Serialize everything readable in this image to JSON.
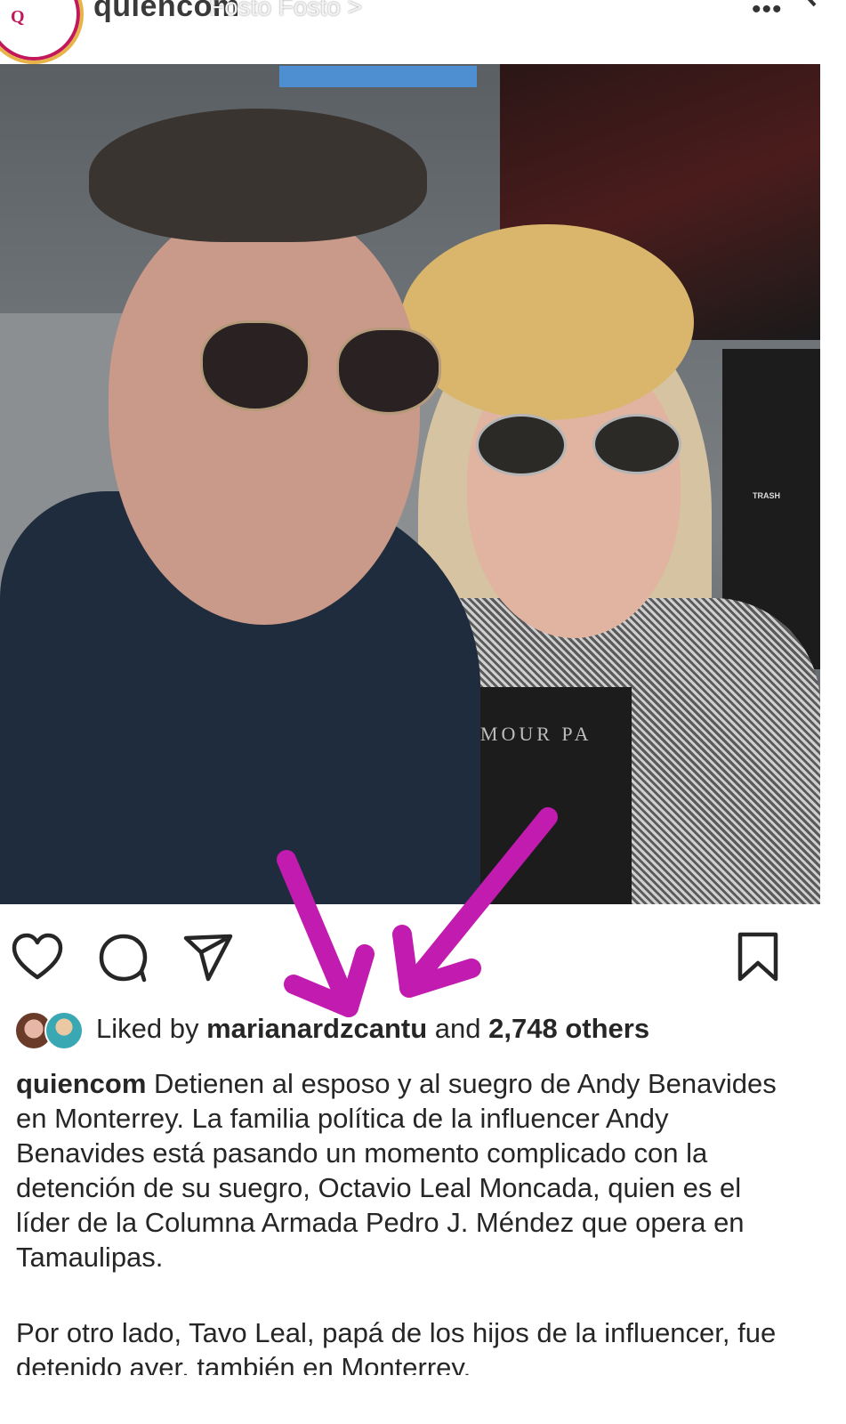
{
  "header": {
    "account_name": "quiencom",
    "logo_text": "Q",
    "audio_label": "Fosto Fosto >",
    "more_icon": "more-icon",
    "close_icon": "close-icon"
  },
  "photo": {
    "sign_text": "",
    "bin_text": "TRASH",
    "shirt_text": "AMOUR PA"
  },
  "actions": {
    "like_icon": "heart-icon",
    "comment_icon": "comment-icon",
    "share_icon": "paper-plane-icon",
    "save_icon": "bookmark-icon"
  },
  "likes": {
    "prefix": "Liked by",
    "user": "marianardzcantu",
    "middle": "and",
    "count": "2,748 others"
  },
  "caption": {
    "username": "quiencom",
    "paragraph1": "Detienen al esposo y al suegro de Andy Benavides en Monterrey. La familia política de la influencer Andy Benavides está pasando un momento complicado con la detención de su suegro, Octavio Leal Moncada, quien es el líder de la Columna Armada Pedro J. Méndez que opera en Tamaulipas.",
    "paragraph2": "Por otro lado, Tavo Leal, papá de los hijos de la influencer, fue detenido ayer, también en Monterrey."
  },
  "colors": {
    "arrow": "#c21bb0",
    "text": "#262626"
  }
}
